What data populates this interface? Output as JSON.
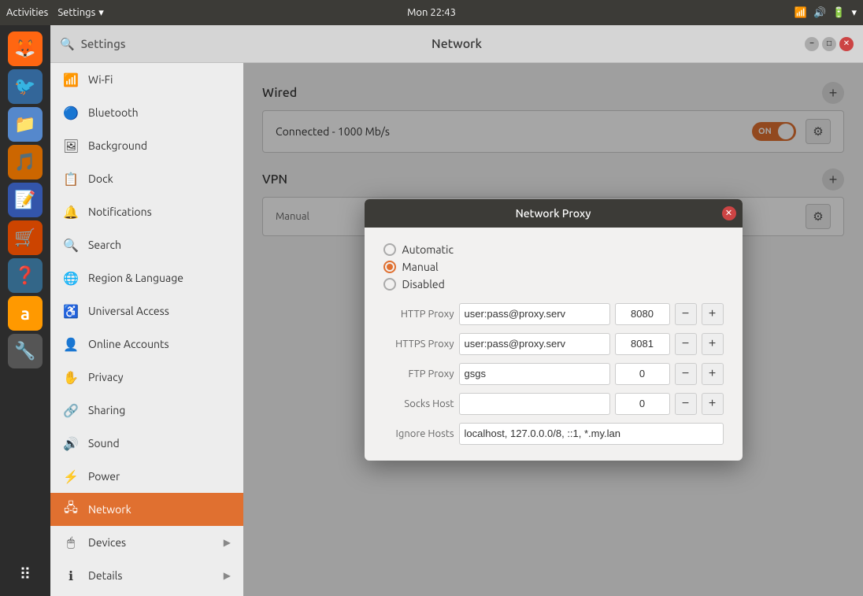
{
  "topbar": {
    "activities": "Activities",
    "settings_menu": "Settings",
    "time": "Mon 22:43"
  },
  "sidebar": {
    "search_placeholder": "Settings",
    "items": [
      {
        "id": "wifi",
        "icon": "📶",
        "label": "Wi-Fi"
      },
      {
        "id": "bluetooth",
        "icon": "🔵",
        "label": "Bluetooth"
      },
      {
        "id": "background",
        "icon": "🖼",
        "label": "Background"
      },
      {
        "id": "dock",
        "icon": "📋",
        "label": "Dock"
      },
      {
        "id": "notifications",
        "icon": "🔔",
        "label": "Notifications"
      },
      {
        "id": "search",
        "icon": "🔍",
        "label": "Search"
      },
      {
        "id": "region",
        "icon": "🌐",
        "label": "Region & Language"
      },
      {
        "id": "universal",
        "icon": "♿",
        "label": "Universal Access"
      },
      {
        "id": "online-accounts",
        "icon": "👤",
        "label": "Online Accounts"
      },
      {
        "id": "privacy",
        "icon": "✋",
        "label": "Privacy"
      },
      {
        "id": "sharing",
        "icon": "🔗",
        "label": "Sharing"
      },
      {
        "id": "sound",
        "icon": "🔊",
        "label": "Sound"
      },
      {
        "id": "power",
        "icon": "⚡",
        "label": "Power"
      },
      {
        "id": "network",
        "icon": "🖧",
        "label": "Network",
        "active": true
      },
      {
        "id": "devices",
        "icon": "🖱",
        "label": "Devices",
        "arrow": "▶"
      },
      {
        "id": "details",
        "icon": "ℹ",
        "label": "Details",
        "arrow": "▶"
      }
    ]
  },
  "content": {
    "title": "Network",
    "wired_section": {
      "label": "Wired",
      "add_btn": "+",
      "connection_status": "Connected - 1000 Mb/s",
      "toggle_label": "ON"
    },
    "vpn_section": {
      "label": "VPN",
      "add_btn": "+",
      "proxy_label": "Manual"
    }
  },
  "modal": {
    "title": "Network Proxy",
    "close_btn": "✕",
    "options": [
      {
        "id": "automatic",
        "label": "Automatic",
        "selected": false
      },
      {
        "id": "manual",
        "label": "Manual",
        "selected": true
      },
      {
        "id": "disabled",
        "label": "Disabled",
        "selected": false
      }
    ],
    "http_proxy": {
      "label": "HTTP Proxy",
      "host_value": "user:pass@proxy.serv",
      "port_value": "8080"
    },
    "https_proxy": {
      "label": "HTTPS Proxy",
      "host_value": "user:pass@proxy.serv",
      "port_value": "8081"
    },
    "ftp_proxy": {
      "label": "FTP Proxy",
      "host_value": "gsgs",
      "port_value": "0"
    },
    "socks_host": {
      "label": "Socks Host",
      "host_value": "",
      "port_value": "0"
    },
    "ignore_hosts": {
      "label": "Ignore Hosts",
      "value": "localhost, 127.0.0.0/8, ::1, *.my.lan"
    }
  },
  "dock_icons": [
    {
      "id": "firefox",
      "emoji": "🦊",
      "bg": "#ff6611"
    },
    {
      "id": "thunderbird",
      "emoji": "🐦",
      "bg": "#336699"
    },
    {
      "id": "files",
      "emoji": "📁",
      "bg": "#5588cc"
    },
    {
      "id": "rhythmbox",
      "emoji": "🎵",
      "bg": "#cc6600"
    },
    {
      "id": "writer",
      "emoji": "📝",
      "bg": "#3355aa"
    },
    {
      "id": "software",
      "emoji": "🛒",
      "bg": "#cc4400"
    },
    {
      "id": "help",
      "emoji": "❓",
      "bg": "#336688"
    },
    {
      "id": "amazon",
      "emoji": "🅰",
      "bg": "#ff9900"
    },
    {
      "id": "tools",
      "emoji": "🔧",
      "bg": "#888888"
    }
  ],
  "win_controls": {
    "minimize": "−",
    "maximize": "□",
    "close": "✕"
  }
}
